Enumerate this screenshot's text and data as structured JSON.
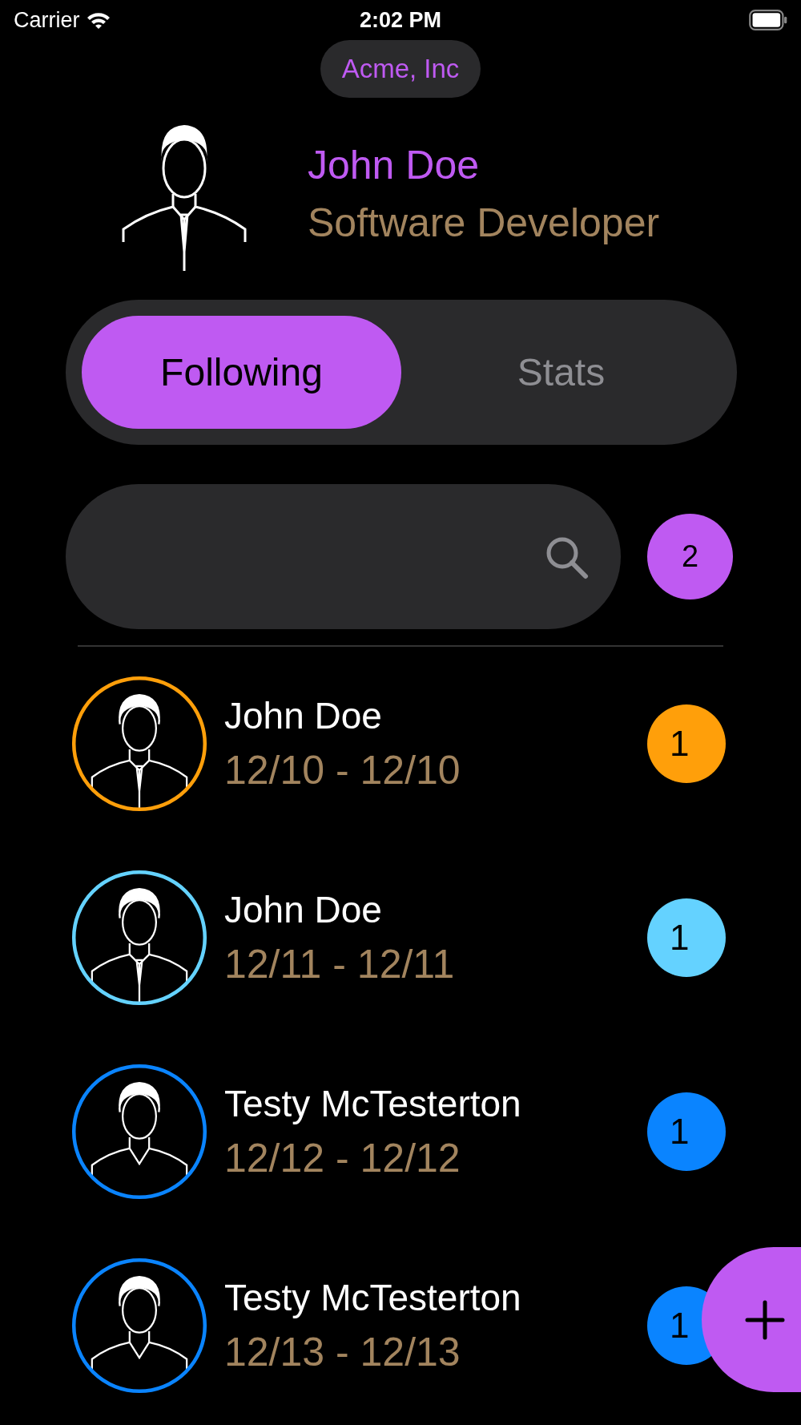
{
  "status_bar": {
    "carrier": "Carrier",
    "time": "2:02 PM"
  },
  "organization": "Acme, Inc",
  "profile": {
    "name": "John Doe",
    "title": "Software Developer"
  },
  "tabs": [
    {
      "label": "Following",
      "selected": true
    },
    {
      "label": "Stats",
      "selected": false
    }
  ],
  "search": {
    "count": "2"
  },
  "people": [
    {
      "name": "John Doe",
      "dates": "12/10 - 12/10",
      "count": "1",
      "color": "#ff9f0a",
      "kind": "suit"
    },
    {
      "name": "John Doe",
      "dates": "12/11 - 12/11",
      "count": "1",
      "color": "#64d2ff",
      "kind": "suit"
    },
    {
      "name": "Testy McTesterton",
      "dates": "12/12 - 12/12",
      "count": "1",
      "color": "#0a84ff",
      "kind": "casual"
    },
    {
      "name": "Testy McTesterton",
      "dates": "12/13 - 12/13",
      "count": "1",
      "color": "#0a84ff",
      "kind": "casual"
    }
  ]
}
